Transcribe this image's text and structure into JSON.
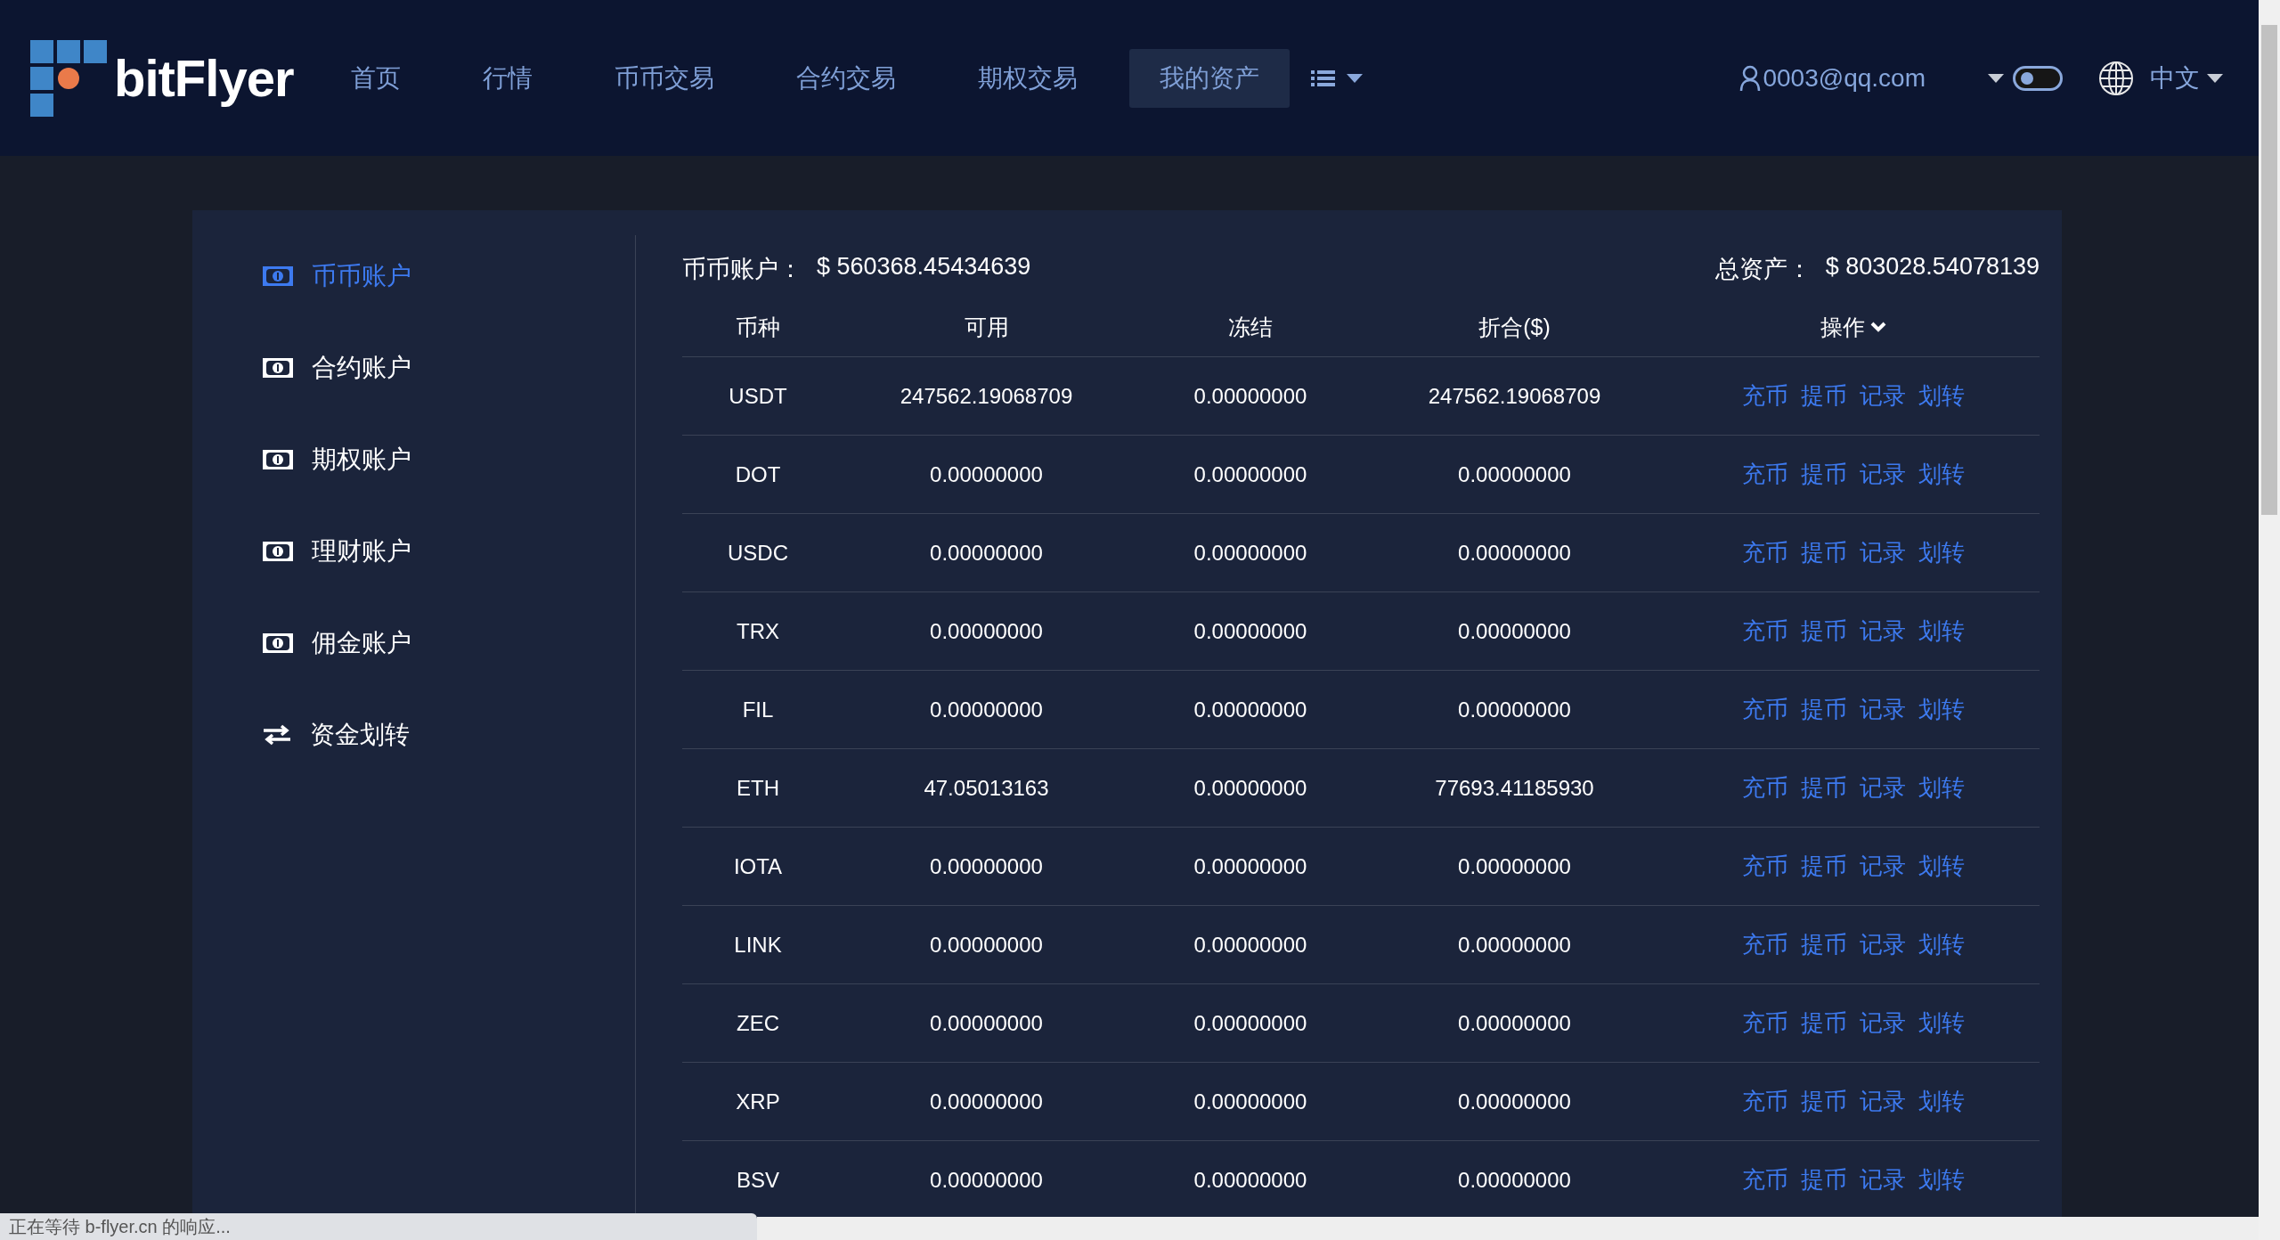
{
  "header": {
    "logo": "bitFlyer",
    "nav": [
      {
        "label": "首页",
        "selected": false
      },
      {
        "label": "行情",
        "selected": false
      },
      {
        "label": "币币交易",
        "selected": false
      },
      {
        "label": "合约交易",
        "selected": false
      },
      {
        "label": "期权交易",
        "selected": false
      },
      {
        "label": "我的资产",
        "selected": true
      }
    ],
    "user": "0003@qq.com",
    "theme_toggle": {
      "on": false
    },
    "language": "中文"
  },
  "sidebar": {
    "items": [
      {
        "label": "币币账户",
        "kind": "account",
        "selected": true
      },
      {
        "label": "合约账户",
        "kind": "account",
        "selected": false
      },
      {
        "label": "期权账户",
        "kind": "account",
        "selected": false
      },
      {
        "label": "理财账户",
        "kind": "account",
        "selected": false
      },
      {
        "label": "佣金账户",
        "kind": "account",
        "selected": false
      },
      {
        "label": "资金划转",
        "kind": "transfer",
        "selected": false
      }
    ]
  },
  "summary": {
    "account_label": "币币账户：",
    "account_value": "$ 560368.45434639",
    "total_label": "总资产：",
    "total_value": "$ 803028.54078139"
  },
  "table": {
    "columns": [
      "币种",
      "可用",
      "冻结",
      "折合($)",
      "操作"
    ],
    "rows": [
      {
        "cells": [
          "USDT",
          "247562.19068709",
          "0.00000000",
          "247562.19068709"
        ],
        "actions": [
          "充币",
          "提币",
          "记录",
          "划转"
        ]
      },
      {
        "cells": [
          "DOT",
          "0.00000000",
          "0.00000000",
          "0.00000000"
        ],
        "actions": [
          "充币",
          "提币",
          "记录",
          "划转"
        ]
      },
      {
        "cells": [
          "USDC",
          "0.00000000",
          "0.00000000",
          "0.00000000"
        ],
        "actions": [
          "充币",
          "提币",
          "记录",
          "划转"
        ]
      },
      {
        "cells": [
          "TRX",
          "0.00000000",
          "0.00000000",
          "0.00000000"
        ],
        "actions": [
          "充币",
          "提币",
          "记录",
          "划转"
        ]
      },
      {
        "cells": [
          "FIL",
          "0.00000000",
          "0.00000000",
          "0.00000000"
        ],
        "actions": [
          "充币",
          "提币",
          "记录",
          "划转"
        ]
      },
      {
        "cells": [
          "ETH",
          "47.05013163",
          "0.00000000",
          "77693.41185930"
        ],
        "actions": [
          "充币",
          "提币",
          "记录",
          "划转"
        ]
      },
      {
        "cells": [
          "IOTA",
          "0.00000000",
          "0.00000000",
          "0.00000000"
        ],
        "actions": [
          "充币",
          "提币",
          "记录",
          "划转"
        ]
      },
      {
        "cells": [
          "LINK",
          "0.00000000",
          "0.00000000",
          "0.00000000"
        ],
        "actions": [
          "充币",
          "提币",
          "记录",
          "划转"
        ]
      },
      {
        "cells": [
          "ZEC",
          "0.00000000",
          "0.00000000",
          "0.00000000"
        ],
        "actions": [
          "充币",
          "提币",
          "记录",
          "划转"
        ]
      },
      {
        "cells": [
          "XRP",
          "0.00000000",
          "0.00000000",
          "0.00000000"
        ],
        "actions": [
          "充币",
          "提币",
          "记录",
          "划转"
        ]
      },
      {
        "cells": [
          "BSV",
          "0.00000000",
          "0.00000000",
          "0.00000000"
        ],
        "actions": [
          "充币",
          "提币",
          "记录",
          "划转"
        ]
      }
    ]
  },
  "status_bar": "正在等待 b-flyer.cn 的响应..."
}
